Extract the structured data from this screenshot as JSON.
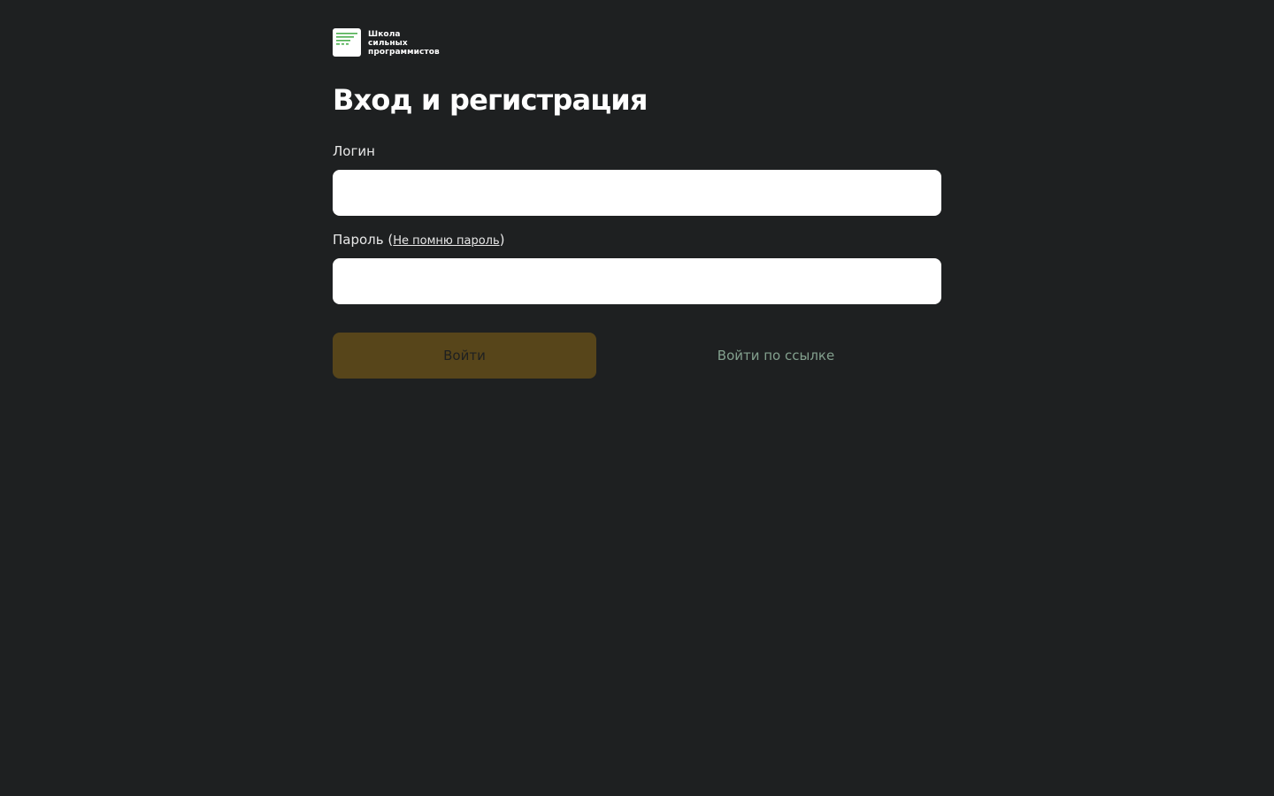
{
  "logo": {
    "line1": "Школа",
    "line2": "сильных",
    "line3": "программистов",
    "accent_color": "#4caf50"
  },
  "page_title": "Вход и регистрация",
  "login": {
    "label": "Логин",
    "value": "",
    "placeholder": ""
  },
  "password": {
    "label": "Пароль",
    "paren_open": "(",
    "forgot_link": "Не помню пароль",
    "paren_close": ")",
    "value": "",
    "placeholder": ""
  },
  "actions": {
    "submit_label": "Войти",
    "magic_link_label": "Войти по ссылке"
  },
  "colors": {
    "background": "#1e2021",
    "submit_bg": "#57451a",
    "link_color": "#83a08e"
  }
}
